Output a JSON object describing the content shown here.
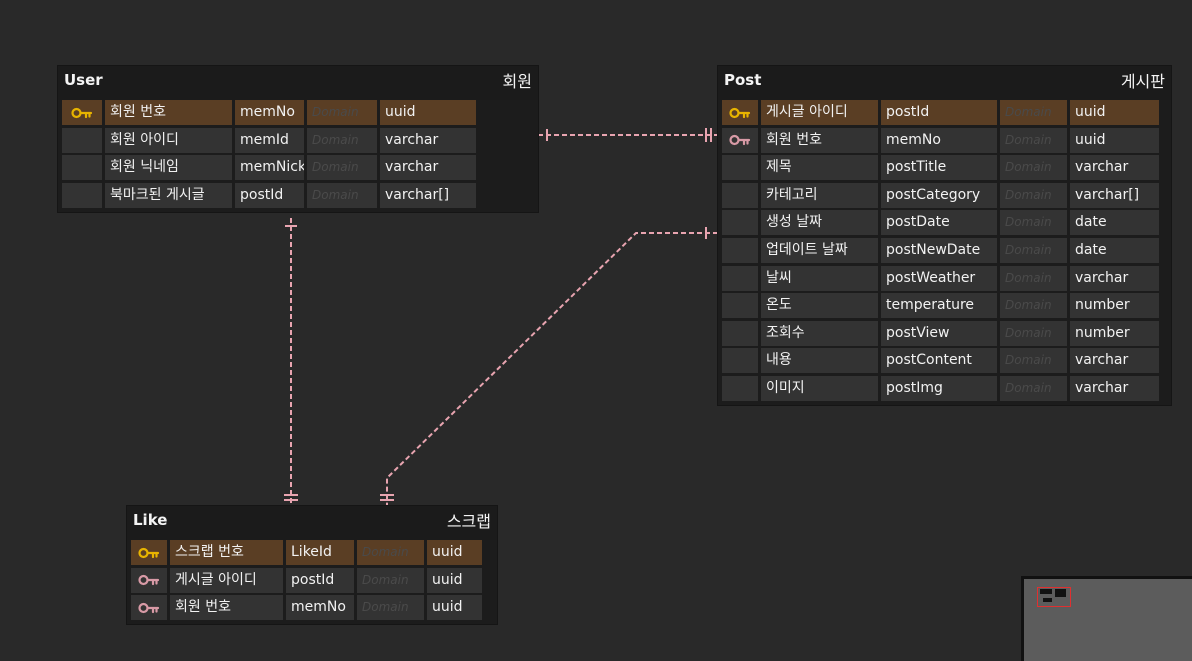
{
  "tables": [
    {
      "id": "user",
      "name": "User",
      "logical": "회원",
      "columns": [
        {
          "logical": "회원 번호",
          "physical": "memNo",
          "domain": "Domain",
          "type": "uuid",
          "key": "pk"
        },
        {
          "logical": "회원 아이디",
          "physical": "memId",
          "domain": "Domain",
          "type": "varchar",
          "key": ""
        },
        {
          "logical": "회원 닉네임",
          "physical": "memNickname",
          "domain": "Domain",
          "type": "varchar",
          "key": ""
        },
        {
          "logical": "북마크된 게시글",
          "physical": "postId",
          "domain": "Domain",
          "type": "varchar[]",
          "key": ""
        }
      ]
    },
    {
      "id": "post",
      "name": "Post",
      "logical": "게시판",
      "columns": [
        {
          "logical": "게시글 아이디",
          "physical": "postId",
          "domain": "Domain",
          "type": "uuid",
          "key": "pk"
        },
        {
          "logical": "회원 번호",
          "physical": "memNo",
          "domain": "Domain",
          "type": "uuid",
          "key": "fk"
        },
        {
          "logical": "제목",
          "physical": "postTitle",
          "domain": "Domain",
          "type": "varchar",
          "key": ""
        },
        {
          "logical": "카테고리",
          "physical": "postCategory",
          "domain": "Domain",
          "type": "varchar[]",
          "key": ""
        },
        {
          "logical": "생성 날짜",
          "physical": "postDate",
          "domain": "Domain",
          "type": "date",
          "key": ""
        },
        {
          "logical": "업데이트 날짜",
          "physical": "postNewDate",
          "domain": "Domain",
          "type": "date",
          "key": ""
        },
        {
          "logical": "날씨",
          "physical": "postWeather",
          "domain": "Domain",
          "type": "varchar",
          "key": ""
        },
        {
          "logical": "온도",
          "physical": "temperature",
          "domain": "Domain",
          "type": "number",
          "key": ""
        },
        {
          "logical": "조회수",
          "physical": "postView",
          "domain": "Domain",
          "type": "number",
          "key": ""
        },
        {
          "logical": "내용",
          "physical": "postContent",
          "domain": "Domain",
          "type": "varchar",
          "key": ""
        },
        {
          "logical": "이미지",
          "physical": "postImg",
          "domain": "Domain",
          "type": "varchar",
          "key": ""
        }
      ]
    },
    {
      "id": "like",
      "name": "Like",
      "logical": "스크랩",
      "columns": [
        {
          "logical": "스크랩 번호",
          "physical": "LikeId",
          "domain": "Domain",
          "type": "uuid",
          "key": "pk"
        },
        {
          "logical": "게시글 아이디",
          "physical": "postId",
          "domain": "Domain",
          "type": "uuid",
          "key": "fk"
        },
        {
          "logical": "회원 번호",
          "physical": "memNo",
          "domain": "Domain",
          "type": "uuid",
          "key": "fk"
        }
      ]
    }
  ],
  "relations": [
    {
      "from": "user",
      "to": "post",
      "cardinality": "one-to-one-or-many"
    },
    {
      "from": "user",
      "to": "like",
      "cardinality": "one-to-one-or-many"
    },
    {
      "from": "post",
      "to": "like",
      "cardinality": "one-to-one-or-many"
    }
  ],
  "colors": {
    "background": "#292929",
    "pk_row": "#5a3e24",
    "pk_key": "#e8b400",
    "fk_key": "#d89aa6",
    "relation_line": "#e8a4b0"
  },
  "icons": {
    "pk": "primary-key-icon",
    "fk": "foreign-key-icon"
  },
  "minimap": {
    "visible": true
  }
}
